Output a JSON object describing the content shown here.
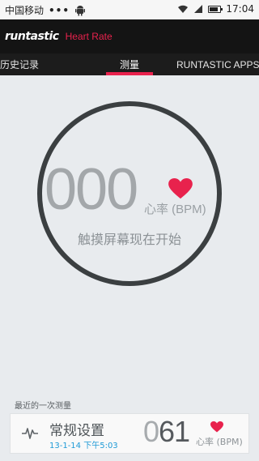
{
  "status_bar": {
    "carrier": "中国移动",
    "dots": "•••",
    "time": "17:04",
    "battery_level": 0.8
  },
  "app_bar": {
    "brand": "runtastic",
    "subtitle": "Heart Rate",
    "accent_color": "#e8224d"
  },
  "tabs": [
    {
      "label": "历史记录"
    },
    {
      "label": "测量"
    },
    {
      "label": "RUNTASTIC APPS"
    }
  ],
  "active_tab": "测量",
  "measure": {
    "value": "000",
    "unit": "心率 (BPM)",
    "prompt": "触摸屏幕现在开始"
  },
  "last_measurement": {
    "section_title": "最近的一次测量",
    "title": "常规设置",
    "date": "13-1-14 下午5:03",
    "value_lead": "0",
    "value_rest": "61",
    "unit": "心率 (BPM)"
  },
  "icons": {
    "heart": "heart-icon",
    "pulse": "pulse-icon"
  }
}
